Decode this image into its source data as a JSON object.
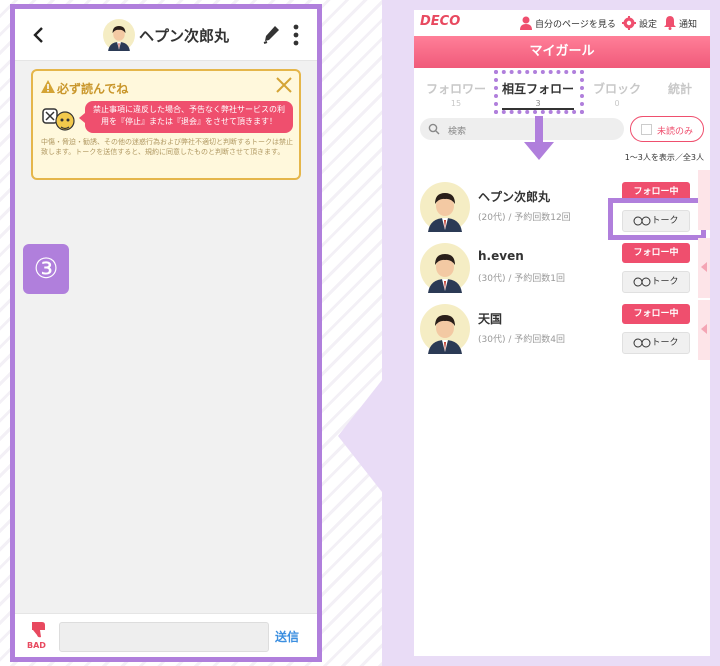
{
  "chat": {
    "user_name": "ヘプン次郎丸",
    "notice": {
      "title": "必ず読んでね",
      "highlight": "禁止事項に違反した場合、予告なく弊社サービスの利用を『停止』または『退会』をさせて頂きます！",
      "body": "中傷・脅迫・勧誘、その他の迷惑行為および弊社不適切と判断するトークは禁止致します。トークを送信すると、規約に同意したものと判断させて頂きます。"
    },
    "step_label": "③",
    "bad_label": "BAD",
    "send_label": "送信"
  },
  "app": {
    "logo": "DECO",
    "mypage_label": "自分のページを見る",
    "settings_label": "設定",
    "notify_label": "通知",
    "title": "マイガール"
  },
  "tabs": [
    {
      "label": "フォロワー",
      "count": "15"
    },
    {
      "label": "相互フォロー",
      "count": "3"
    },
    {
      "label": "ブロック",
      "count": "0"
    },
    {
      "label": "統計",
      "count": ""
    }
  ],
  "search": {
    "placeholder": "検索",
    "unread_label": "未読のみ"
  },
  "count_text": "1〜3人を表示／全3人",
  "follow_label": "フォロー中",
  "talk_label": "トーク",
  "users": [
    {
      "name": "ヘプン次郎丸",
      "meta": "(20代) / 予約回数12回"
    },
    {
      "name": "h.even",
      "meta": "(30代) / 予約回数1回"
    },
    {
      "name": "天国",
      "meta": "(30代) / 予約回数4回"
    }
  ],
  "colors": {
    "accent": "#ef4f6e",
    "highlight": "#b07fdc",
    "link": "#3c8fe0"
  }
}
